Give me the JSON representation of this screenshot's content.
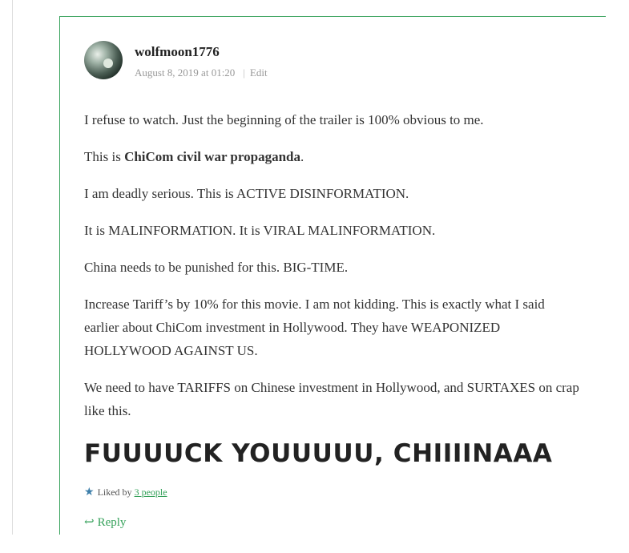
{
  "comment": {
    "author": "wolfmoon1776",
    "date": "August 8, 2019 at 01:20",
    "separator": "|",
    "edit_label": "Edit",
    "body": {
      "p1": "I refuse to watch. Just the beginning of the trailer is 100% obvious to me.",
      "p2_prefix": "This is ",
      "p2_bold": "ChiCom civil war propaganda",
      "p2_suffix": ".",
      "p3": "I am deadly serious. This is ACTIVE DISINFORMATION.",
      "p4": "It is MALINFORMATION. It is VIRAL MALINFORMATION.",
      "p5": "China needs to be punished for this. BIG-TIME.",
      "p6": "Increase Tariff’s by 10% for this movie. I am not kidding. This is exactly what I said earlier about ChiCom investment in Hollywood. They have WEAPONIZED HOLLYWOOD AGAINST US.",
      "p7": "We need to have TARIFFS on Chinese investment in Hollywood, and SURTAXES on crap like this.",
      "shout": "FUUUUCK YOUUUUU, CHIIIINAAA"
    },
    "likes": {
      "icon": "star-icon",
      "prefix": "Liked by",
      "link_text": "3 people"
    },
    "reply": {
      "icon": "reply-arrow-icon",
      "label": "Reply"
    },
    "colors": {
      "accent": "#35a15a",
      "star": "#3d7eaa",
      "text": "#333333",
      "meta": "#999999"
    }
  }
}
